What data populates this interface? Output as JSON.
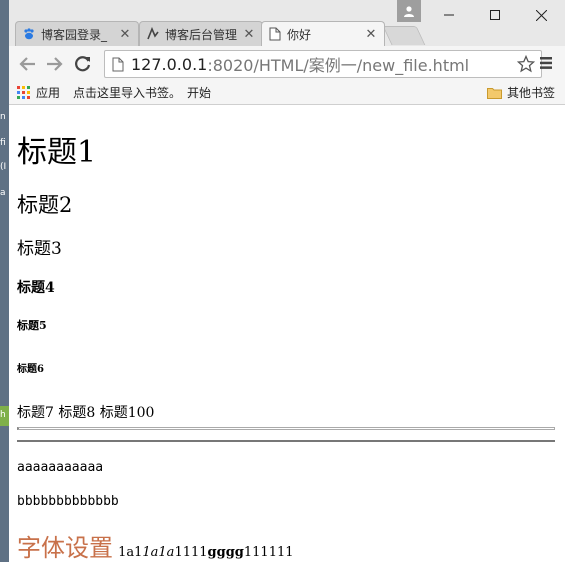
{
  "background": {
    "strip_texts": [
      "n",
      "fi",
      "(I",
      "a",
      "h"
    ]
  },
  "tabs": [
    {
      "label": "博客园登录_",
      "icon": "paw-icon",
      "active": false
    },
    {
      "label": "博客后台管理",
      "icon": "logo-icon",
      "active": false
    },
    {
      "label": "你好",
      "icon": "page-icon",
      "active": true
    }
  ],
  "toolbar": {
    "url_host": "127.0.0.1",
    "url_path": ":8020/HTML/案例一/new_file.html"
  },
  "bookmarks": {
    "apps": "应用",
    "import_hint": "点击这里导入书签。",
    "start": "开始",
    "other": "其他书签"
  },
  "page": {
    "h1": "标题1",
    "h2": "标题2",
    "h3": "标题3",
    "h4": "标题4",
    "h5": "标题5",
    "h6": "标题6",
    "inline_headings": "标题7 标题8 标题100",
    "line_a": "aaaaaaaaaaa",
    "line_b": "bbbbbbbbbbbbb",
    "font_title": "字体设置",
    "font_part1": "1a1",
    "font_part2": "1a1a",
    "font_part3": "1111",
    "font_part4": "gggg",
    "font_part5": "111111"
  },
  "colors": {
    "font_title": "#c8714a",
    "desktop": "#6b7d8f"
  }
}
